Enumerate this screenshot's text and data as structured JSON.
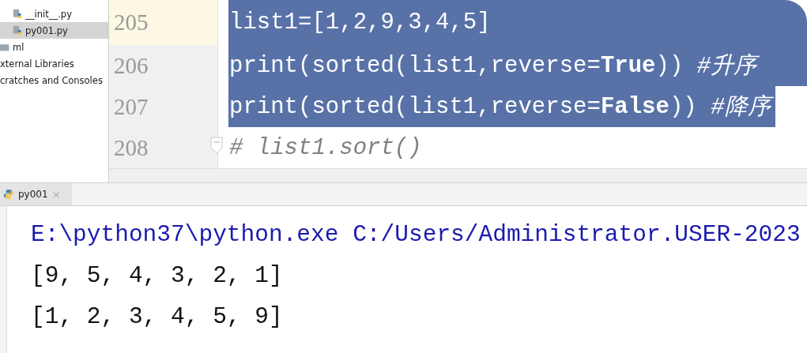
{
  "project_tree": [
    {
      "label": "__init__.py",
      "kind": "python-file",
      "selected": false
    },
    {
      "label": "py001.py",
      "kind": "python-file",
      "selected": true
    },
    {
      "label": "ml",
      "kind": "folder",
      "selected": false
    },
    {
      "label": "xternal Libraries",
      "kind": "text",
      "selected": false
    },
    {
      "label": "cratches and Consoles",
      "kind": "text",
      "selected": false
    }
  ],
  "editor": {
    "lines": [
      {
        "number": "205",
        "code": "list1=[1,2,9,3,4,5]",
        "kind": "code",
        "selected": true,
        "current": true
      },
      {
        "number": "206",
        "code": "print(sorted(list1,reverse=**True**)) *#升序*",
        "kind": "code",
        "selected": true,
        "current": false
      },
      {
        "number": "207",
        "code": "print(sorted(list1,reverse=**False**)) *#降序*",
        "kind": "code",
        "selected": true,
        "current": false
      },
      {
        "number": "208",
        "code": "# list1.sort()",
        "kind": "comment",
        "selected": false,
        "current": false
      }
    ]
  },
  "run_tab": {
    "label": "py001",
    "close": "×"
  },
  "console": [
    {
      "text": "E:\\python37\\python.exe C:/Users/Administrator.USER-2023",
      "kind": "command"
    },
    {
      "text": "[9, 5, 4, 3, 2, 1]",
      "kind": "output"
    },
    {
      "text": "[1, 2, 3, 4, 5, 9]",
      "kind": "output"
    }
  ]
}
